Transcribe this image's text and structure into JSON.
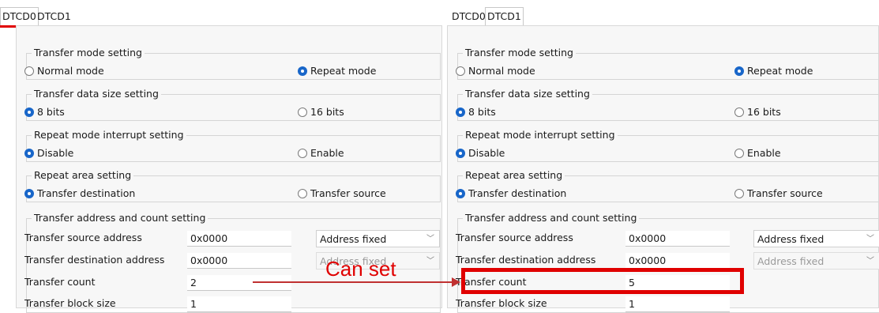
{
  "panels": [
    {
      "tabs": [
        {
          "label": "DTCD0"
        },
        {
          "label": "DTCD1"
        }
      ],
      "active_tab": "DTCD0",
      "groups": {
        "transfer_mode": {
          "title": "Transfer mode setting",
          "options": [
            {
              "label": "Normal mode",
              "selected": false
            },
            {
              "label": "Repeat mode",
              "selected": true
            }
          ]
        },
        "data_size": {
          "title": "Transfer data size setting",
          "options": [
            {
              "label": "8 bits",
              "selected": true
            },
            {
              "label": "16 bits",
              "selected": false
            }
          ]
        },
        "repeat_interrupt": {
          "title": "Repeat mode interrupt setting",
          "options": [
            {
              "label": "Disable",
              "selected": true
            },
            {
              "label": "Enable",
              "selected": false
            }
          ]
        },
        "repeat_area": {
          "title": "Repeat area setting",
          "options": [
            {
              "label": "Transfer destination",
              "selected": true
            },
            {
              "label": "Transfer source",
              "selected": false
            }
          ]
        },
        "address_count": {
          "title": "Transfer address and count setting",
          "rows": [
            {
              "label": "Transfer source address",
              "value": "0x0000",
              "select": "Address fixed",
              "select_enabled": true
            },
            {
              "label": "Transfer destination address",
              "value": "0x0000",
              "select": "Address fixed",
              "select_enabled": false
            },
            {
              "label": "Transfer count",
              "value": "2"
            },
            {
              "label": "Transfer block size",
              "value": "1"
            }
          ]
        }
      }
    },
    {
      "tabs": [
        {
          "label": "DTCD0"
        },
        {
          "label": "DTCD1"
        }
      ],
      "active_tab": "DTCD1",
      "groups": {
        "transfer_mode": {
          "title": "Transfer mode setting",
          "options": [
            {
              "label": "Normal mode",
              "selected": false
            },
            {
              "label": "Repeat mode",
              "selected": true
            }
          ]
        },
        "data_size": {
          "title": "Transfer data size setting",
          "options": [
            {
              "label": "8 bits",
              "selected": true
            },
            {
              "label": "16 bits",
              "selected": false
            }
          ]
        },
        "repeat_interrupt": {
          "title": "Repeat mode interrupt setting",
          "options": [
            {
              "label": "Disable",
              "selected": true
            },
            {
              "label": "Enable",
              "selected": false
            }
          ]
        },
        "repeat_area": {
          "title": "Repeat area setting",
          "options": [
            {
              "label": "Transfer destination",
              "selected": true
            },
            {
              "label": "Transfer source",
              "selected": false
            }
          ]
        },
        "address_count": {
          "title": "Transfer address and count setting",
          "rows": [
            {
              "label": "Transfer source address",
              "value": "0x0000",
              "select": "Address fixed",
              "select_enabled": true
            },
            {
              "label": "Transfer destination address",
              "value": "0x0000",
              "select": "Address fixed",
              "select_enabled": false
            },
            {
              "label": "Transfer count",
              "value": "5"
            },
            {
              "label": "Transfer block size",
              "value": "1"
            }
          ]
        }
      }
    }
  ],
  "annotation": {
    "text": "Can set",
    "color": "#e00000"
  },
  "colors": {
    "radio_selected": "#1866c9",
    "underline": "#e00000"
  }
}
